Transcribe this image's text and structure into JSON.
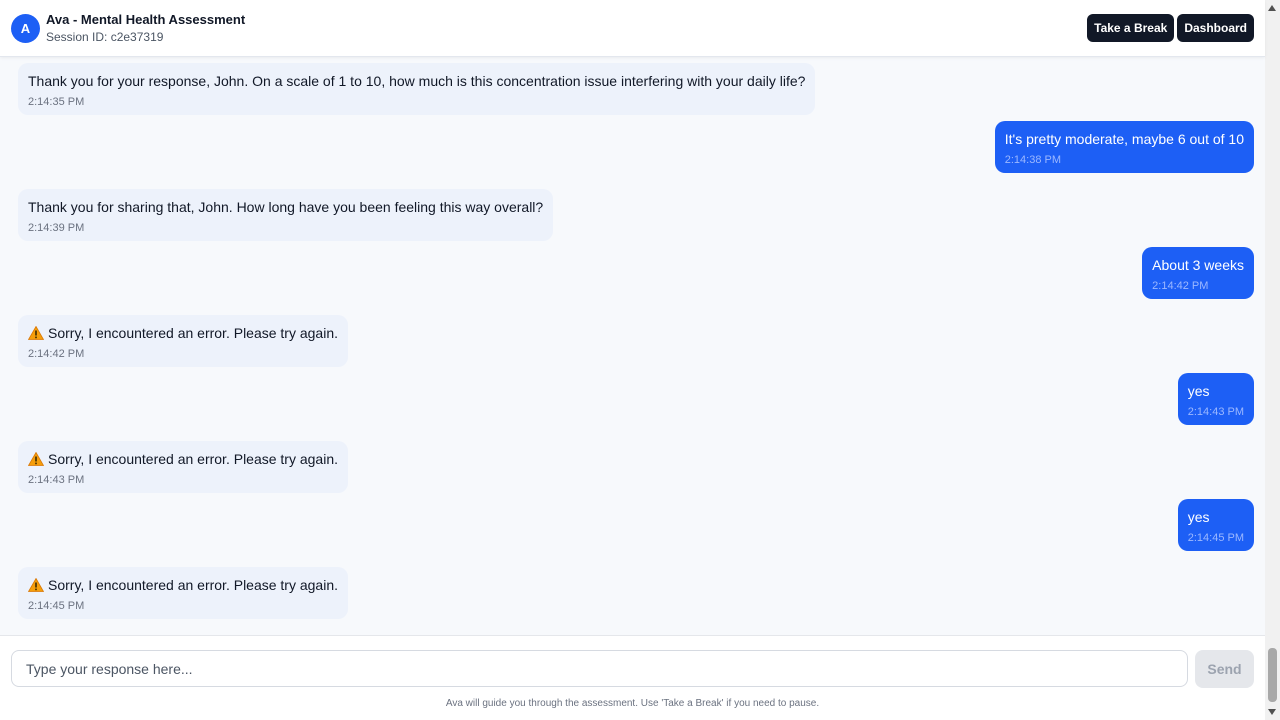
{
  "header": {
    "avatar_letter": "A",
    "title": "Ava - Mental Health Assessment",
    "session": "Session ID: c2e37319",
    "break_label": "Take a Break",
    "dashboard_label": "Dashboard"
  },
  "messages": [
    {
      "role": "ai",
      "text": "Thank you for your response, John. On a scale of 1 to 10, how much is this concentration issue interfering with your daily life?",
      "time": "2:14:35 PM"
    },
    {
      "role": "user",
      "text": "It's pretty moderate, maybe 6 out of 10",
      "time": "2:14:38 PM"
    },
    {
      "role": "ai",
      "text": "Thank you for sharing that, John. How long have you been feeling this way overall?",
      "time": "2:14:39 PM"
    },
    {
      "role": "user",
      "text": "About 3 weeks",
      "time": "2:14:42 PM"
    },
    {
      "role": "ai",
      "text": "Sorry, I encountered an error. Please try again.",
      "time": "2:14:42 PM",
      "icon": "warning-icon"
    },
    {
      "role": "user",
      "text": "yes",
      "time": "2:14:43 PM"
    },
    {
      "role": "ai",
      "text": "Sorry, I encountered an error. Please try again.",
      "time": "2:14:43 PM",
      "icon": "warning-icon"
    },
    {
      "role": "user",
      "text": "yes",
      "time": "2:14:45 PM"
    },
    {
      "role": "ai",
      "text": "Sorry, I encountered an error. Please try again.",
      "time": "2:14:45 PM",
      "icon": "warning-icon"
    }
  ],
  "input": {
    "placeholder": "Type your response here...",
    "value": "",
    "send_label": "Send"
  },
  "footer_hint": "Ava will guide you through the assessment. Use 'Take a Break' if you need to pause.",
  "colors": {
    "accent": "#1d5ff5",
    "ai_bubble": "#edf2fb",
    "header_button": "#111827",
    "warning": "#f59e0b"
  }
}
